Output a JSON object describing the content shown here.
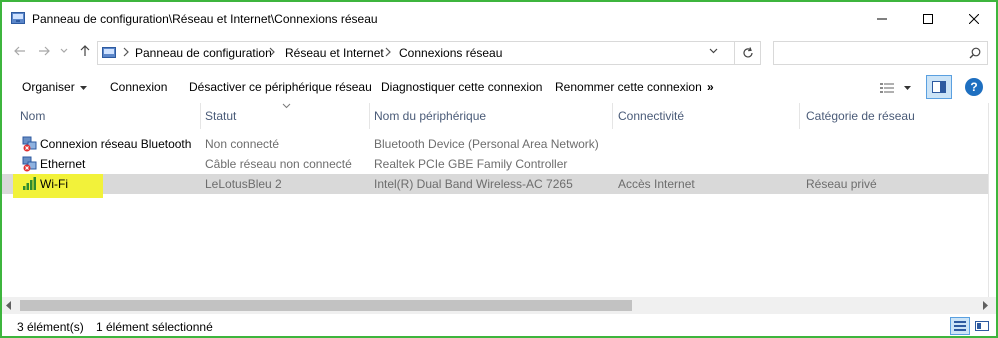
{
  "window": {
    "title": "Panneau de configuration\\Réseau et Internet\\Connexions réseau",
    "controls": {
      "minimize": "—",
      "maximize": "☐",
      "close": "✕"
    }
  },
  "nav": {
    "back_icon": "arrow-left-icon",
    "forward_icon": "arrow-right-icon",
    "recent_icon": "chevron-down-icon",
    "up_icon": "arrow-up-icon",
    "breadcrumb": [
      "Panneau de configuration",
      "Réseau et Internet",
      "Connexions réseau"
    ],
    "search_placeholder": ""
  },
  "toolbar": {
    "organize": "Organiser",
    "items": [
      "Connexion",
      "Désactiver ce périphérique réseau",
      "Diagnostiquer cette connexion",
      "Renommer cette connexion"
    ],
    "more": "»",
    "help": "?"
  },
  "columns": [
    "Nom",
    "Statut",
    "Nom du périphérique",
    "Connectivité",
    "Catégorie de réseau"
  ],
  "rows": [
    {
      "name": "Connexion réseau Bluetooth",
      "status": "Non connecté",
      "device": "Bluetooth Device (Personal Area Network)",
      "connectivity": "",
      "category": "",
      "icon": "bluetooth-network-icon"
    },
    {
      "name": "Ethernet",
      "status": "Câble réseau non connecté",
      "device": "Realtek PCIe GBE Family Controller",
      "connectivity": "",
      "category": "",
      "icon": "ethernet-network-icon"
    },
    {
      "name": "Wi-Fi",
      "status": "LeLotusBleu  2",
      "device": "Intel(R) Dual Band Wireless-AC 7265",
      "connectivity": "Accès Internet",
      "category": "Réseau privé",
      "icon": "wifi-signal-icon"
    }
  ],
  "selected_row": 2,
  "status_bar": {
    "count": "3 élément(s)",
    "selection": "1 élément sélectionné"
  },
  "colors": {
    "highlight": "#f2f23a",
    "selected_row": "#d9d9d9",
    "border": "#3db53d",
    "accent": "#1e6fc0"
  }
}
